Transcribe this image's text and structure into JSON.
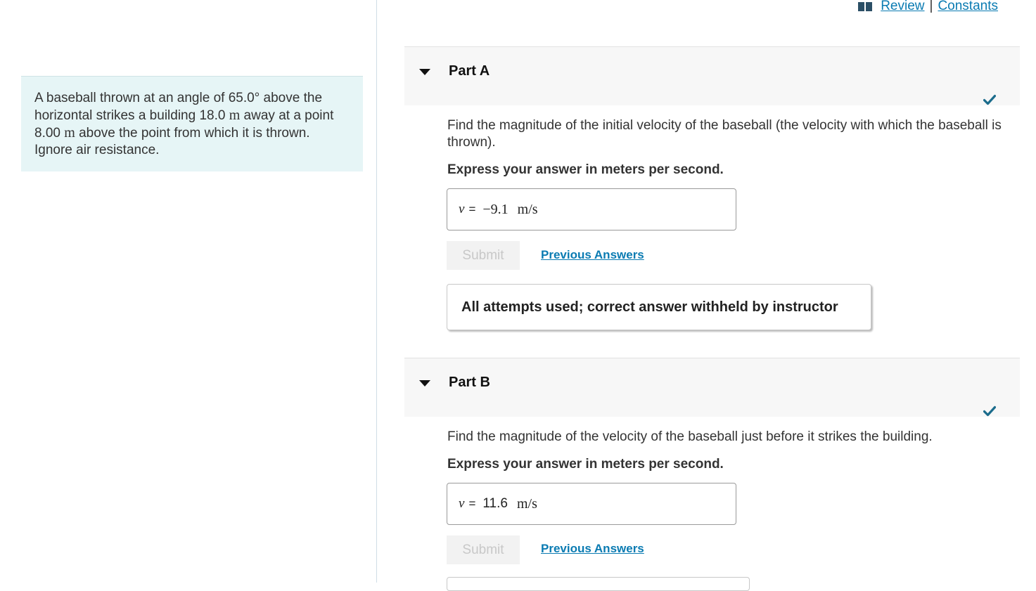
{
  "top_links": {
    "review": "Review",
    "separator": "|",
    "constants": "Constants"
  },
  "problem": {
    "text_1": "A baseball thrown at an angle of 65.0° above the horizontal strikes a building 18.0 ",
    "unit_1": "m",
    "text_2": " away at a point 8.00 ",
    "unit_2": "m",
    "text_3": " above the point from which it is thrown. Ignore air resistance."
  },
  "parts": [
    {
      "title": "Part A",
      "question": "Find the magnitude of the initial velocity of the baseball (the velocity with which the baseball is thrown).",
      "instruction": "Express your answer in meters per second.",
      "variable": "v",
      "equals": "=",
      "value": "−9.1",
      "unit": "m/s",
      "submit_label": "Submit",
      "previous_answers_label": "Previous Answers",
      "feedback": "All attempts used; correct answer withheld by instructor"
    },
    {
      "title": "Part B",
      "question": "Find the magnitude of the velocity of the baseball just before it strikes the building.",
      "instruction": "Express your answer in meters per second.",
      "variable": "v",
      "equals": "=",
      "value": "11.6",
      "unit": "m/s",
      "submit_label": "Submit",
      "previous_answers_label": "Previous Answers"
    }
  ],
  "colors": {
    "link": "#0a7bb2",
    "check": "#1b6c8c",
    "problem_bg": "#e6f5f6"
  },
  "icons": {
    "book": "book-icon",
    "caret": "caret-down-icon",
    "check": "checkmark-icon"
  }
}
